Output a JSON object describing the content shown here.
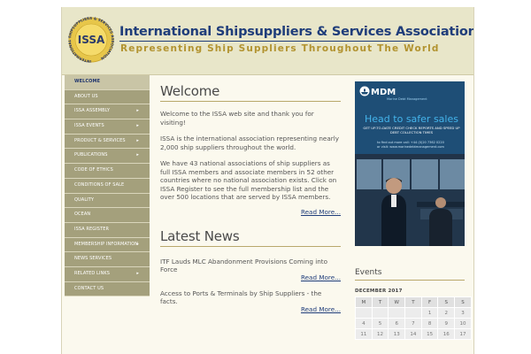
{
  "header": {
    "logo_text": "ISSA",
    "logo_ring_text": "INTERNATIONAL SHIPSUPPLIERS & SERVICES ASSOCIATION",
    "title": "International Shipsuppliers & Services Association",
    "tagline": "Representing Ship Suppliers Throughout The World"
  },
  "sidebar": {
    "items": [
      {
        "label": "Welcome",
        "has_submenu": false,
        "active": true
      },
      {
        "label": "About Us",
        "has_submenu": false
      },
      {
        "label": "ISSA Assembly",
        "has_submenu": true
      },
      {
        "label": "ISSA Events",
        "has_submenu": true
      },
      {
        "label": "Product & Services",
        "has_submenu": true
      },
      {
        "label": "Publications",
        "has_submenu": true
      },
      {
        "label": "Code of Ethics",
        "has_submenu": false
      },
      {
        "label": "Conditions of Sale",
        "has_submenu": false
      },
      {
        "label": "Quality",
        "has_submenu": false
      },
      {
        "label": "Ocean",
        "has_submenu": false
      },
      {
        "label": "ISSA Register",
        "has_submenu": false
      },
      {
        "label": "Membership Information",
        "has_submenu": true
      },
      {
        "label": "News Services",
        "has_submenu": false
      },
      {
        "label": "Related Links",
        "has_submenu": true
      },
      {
        "label": "Contact Us",
        "has_submenu": false
      }
    ],
    "arrow_glyph": "▸"
  },
  "welcome": {
    "heading": "Welcome",
    "paragraphs": [
      "Welcome to the ISSA web site and thank you for visiting!",
      "ISSA is the international association representing nearly 2,000 ship suppliers throughout the world.",
      "We have 43 national associations of ship suppliers as full ISSA members and associate members in 52 other countries where no national association exists. Click on ISSA Register to see the full membership list and the over 500 locations that are served by ISSA members."
    ],
    "read_more": "Read More..."
  },
  "news": {
    "heading": "Latest News",
    "items": [
      {
        "title": "ITF Lauds MLC Abandonment Provisions Coming into Force",
        "read_more": "Read More..."
      },
      {
        "title": "Access to Ports & Terminals by Ship Suppliers - the facts.",
        "read_more": "Read More..."
      }
    ]
  },
  "ad": {
    "brand": "MDM",
    "brand_sub": "Marine Debt Management",
    "headline": "Head to safer sales",
    "subline": "GET UP-TO-DATE CREDIT CHECK REPORTS AND SPEED UP DEBT COLLECTION TIMES",
    "contact_line1": "to find out more call: +44 (0)20 7362 0220",
    "contact_line2": "or visit: www.marinedebtmanagement.com"
  },
  "events": {
    "heading": "Events",
    "month": "DECEMBER 2017",
    "weekdays": [
      "M",
      "T",
      "W",
      "T",
      "F",
      "S",
      "S"
    ],
    "weeks": [
      [
        "",
        "",
        "",
        "",
        "1",
        "2",
        "3"
      ],
      [
        "4",
        "5",
        "6",
        "7",
        "8",
        "9",
        "10"
      ],
      [
        "11",
        "12",
        "13",
        "14",
        "15",
        "16",
        "17"
      ]
    ]
  },
  "colors": {
    "header_bg": "#e8e6c9",
    "nav_bg": "#a4a07c",
    "title_blue": "#1f3d7a",
    "tagline_gold": "#b29330",
    "ad_accent": "#44b3ea"
  }
}
